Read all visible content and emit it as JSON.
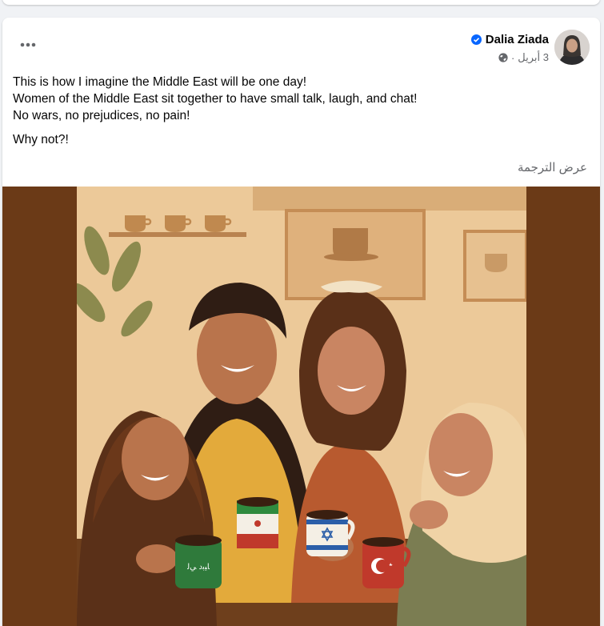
{
  "post": {
    "author_name": "Dalia Ziada",
    "verified": true,
    "timestamp": "3 أبريل",
    "separator": "·",
    "audience_icon": "globe-icon",
    "more_icon": "more-options-icon",
    "text_lines": [
      "This is how I imagine the Middle East will be one day!",
      "Women of the Middle East sit together to have small talk, laugh, and chat!",
      "No wars, no prejudices, no pain!"
    ],
    "closing_line": "Why not?!",
    "see_translation": "عرض الترجمة"
  },
  "image": {
    "mug_labels": [
      "ﺎﻴﺑﺩ ﻲﻟ"
    ]
  },
  "colors": {
    "frame": "#6b3a17",
    "wall": "#ecc999",
    "verified_blue": "#0866ff",
    "secondary_text": "#65676b"
  }
}
